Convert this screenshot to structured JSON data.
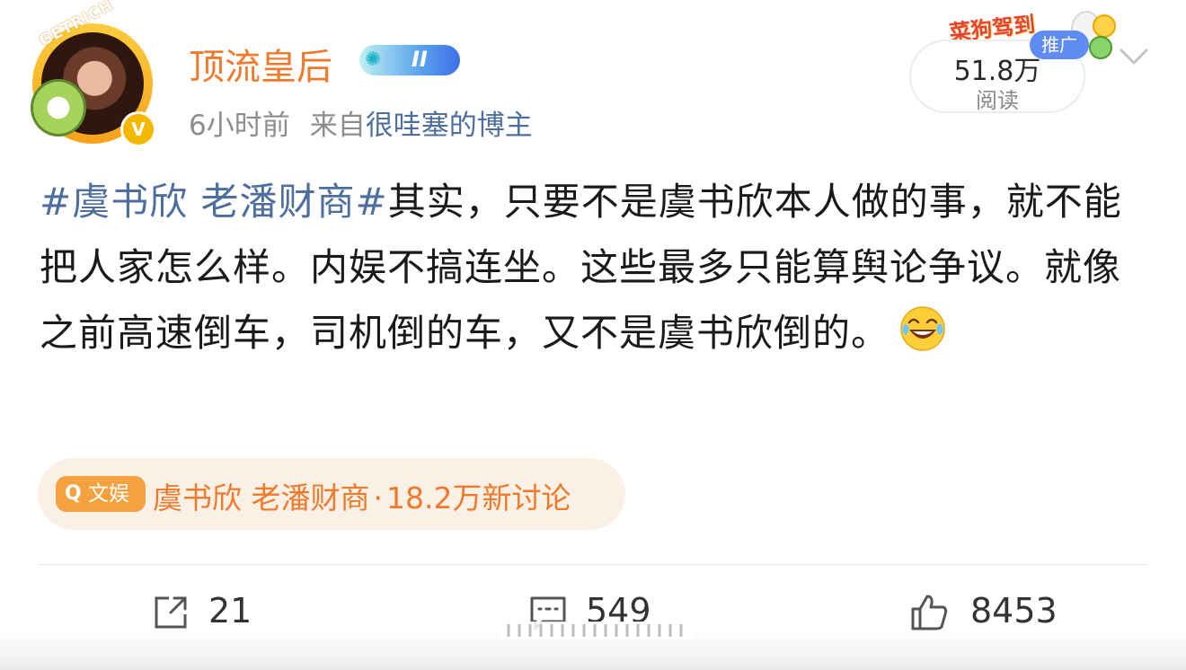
{
  "author": {
    "name": "顶流皇后",
    "avatar_frame_text": "GETRICH",
    "level": "II",
    "verified_badge": "V"
  },
  "meta": {
    "time": "6小时前",
    "source_prefix": "来自",
    "source_name": "很哇塞的博主"
  },
  "promo": {
    "banner_text": "菜狗驾到",
    "ad_label": "推广"
  },
  "stats": {
    "read_count": "51.8万",
    "read_label": "阅读"
  },
  "post": {
    "hashtag": "#虞书欣 老潘财商#",
    "text": "其实，只要不是虞书欣本人做的事，就不能把人家怎么样。内娱不搞连坐。这些最多只能算舆论争议。就像之前高速倒车，司机倒的车，又不是虞书欣倒的。",
    "emoji": "laugh-cry-emoji"
  },
  "topic": {
    "category": "文娱",
    "name": "虞书欣 老潘财商",
    "separator": "·",
    "stats": "18.2万新讨论"
  },
  "actions": {
    "share_count": "21",
    "comment_count": "549",
    "like_count": "8453"
  },
  "colors": {
    "username": "#ef7a2c",
    "link": "#4e6f9e",
    "topic_bg": "#fbf0e6",
    "topic_tag": "#f4a23f",
    "ad_badge": "#5f8cf0"
  }
}
